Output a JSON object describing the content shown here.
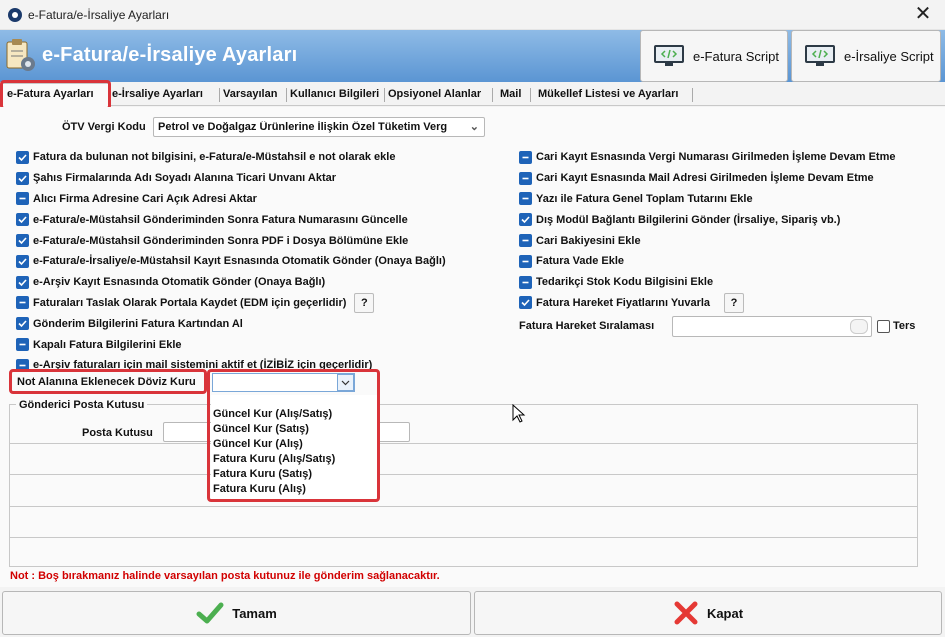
{
  "window": {
    "title": "e-Fatura/e-İrsaliye Ayarları",
    "close_glyph": "✕"
  },
  "header": {
    "title": "e-Fatura/e-İrsaliye Ayarları",
    "efatura_script_label": "e-Fatura Script",
    "eirsaliye_script_label": "e-İrsaliye Script",
    "accent_color": "#5b95d3"
  },
  "tabs": [
    {
      "label": "e-Fatura Ayarları",
      "active": true
    },
    {
      "label": "e-İrsaliye Ayarları"
    },
    {
      "label": "Varsayılan"
    },
    {
      "label": "Kullanıcı Bilgileri"
    },
    {
      "label": "Opsiyonel Alanlar"
    },
    {
      "label": "Mail"
    },
    {
      "label": "Mükellef Listesi ve Ayarları"
    }
  ],
  "otv": {
    "label": "ÖTV Vergi Kodu",
    "value": "Petrol ve Doğalgaz Ürünlerine İlişkin Özel Tüketim Verg"
  },
  "left_checks": [
    {
      "label": "Fatura da bulunan not bilgisini, e-Fatura/e-Müstahsil e not olarak ekle",
      "checked": true
    },
    {
      "label": "Şahıs Firmalarında Adı Soyadı Alanına Ticari Unvanı Aktar",
      "checked": true
    },
    {
      "label": "Alıcı Firma Adresine Cari Açık Adresi Aktar",
      "checked": false
    },
    {
      "label": "e-Fatura/e-Müstahsil Gönderiminden Sonra Fatura Numarasını Güncelle",
      "checked": true
    },
    {
      "label": "e-Fatura/e-Müstahsil Gönderiminden Sonra PDF i Dosya Bölümüne Ekle",
      "checked": true
    },
    {
      "label": "e-Fatura/e-İrsaliye/e-Müstahsil Kayıt Esnasında Otomatik Gönder (Onaya Bağlı)",
      "checked": true
    },
    {
      "label": "e-Arşiv Kayıt Esnasında Otomatik Gönder (Onaya Bağlı)",
      "checked": true
    },
    {
      "label": "Faturaları Taslak Olarak Portala Kaydet (EDM için geçerlidir)",
      "checked": false,
      "help": "?"
    },
    {
      "label": "Gönderim Bilgilerini Fatura Kartından Al",
      "checked": true
    },
    {
      "label": "Kapalı Fatura Bilgilerini Ekle",
      "checked": false
    },
    {
      "label": "e-Arşiv faturaları için mail sistemini aktif et (İZİBİZ için geçerlidir)",
      "checked": false
    }
  ],
  "right_checks": [
    {
      "label": "Cari Kayıt Esnasında Vergi Numarası Girilmeden İşleme Devam Etme",
      "checked": false
    },
    {
      "label": "Cari Kayıt Esnasında Mail Adresi Girilmeden İşleme Devam Etme",
      "checked": false
    },
    {
      "label": "Yazı ile Fatura Genel Toplam Tutarını Ekle",
      "checked": false
    },
    {
      "label": "Dış Modül Bağlantı Bilgilerini Gönder (İrsaliye, Sipariş vb.)",
      "checked": true
    },
    {
      "label": "Cari Bakiyesini Ekle",
      "checked": false
    },
    {
      "label": "Fatura Vade Ekle",
      "checked": false
    },
    {
      "label": "Tedarikçi Stok Kodu Bilgisini Ekle",
      "checked": false
    },
    {
      "label": "Fatura Hareket Fiyatlarını Yuvarla",
      "checked": true,
      "help": "?"
    }
  ],
  "siralama": {
    "label": "Fatura Hareket Sıralaması",
    "value": "",
    "ters_label": "Ters",
    "ters_checked": false
  },
  "doviz": {
    "label": "Not Alanına Eklenecek Döviz Kuru",
    "value": "",
    "options": [
      "Güncel Kur (Alış/Satış)",
      "Güncel Kur (Satış)",
      "Güncel Kur (Alış)",
      "Fatura Kuru (Alış/Satış)",
      "Fatura Kuru (Satış)",
      "Fatura Kuru (Alış)"
    ]
  },
  "posta": {
    "group_label": "Gönderici Posta Kutusu",
    "field_label": "Posta Kutusu",
    "value": ""
  },
  "warning": "Not : Boş bırakmanız halinde varsayılan posta kutunuz ile gönderim sağlanacaktır.",
  "buttons": {
    "ok_label": "Tamam",
    "close_label": "Kapat"
  },
  "colors": {
    "highlight": "#d9343a",
    "checkbox": "#1e63b8",
    "warning": "#d10000"
  }
}
